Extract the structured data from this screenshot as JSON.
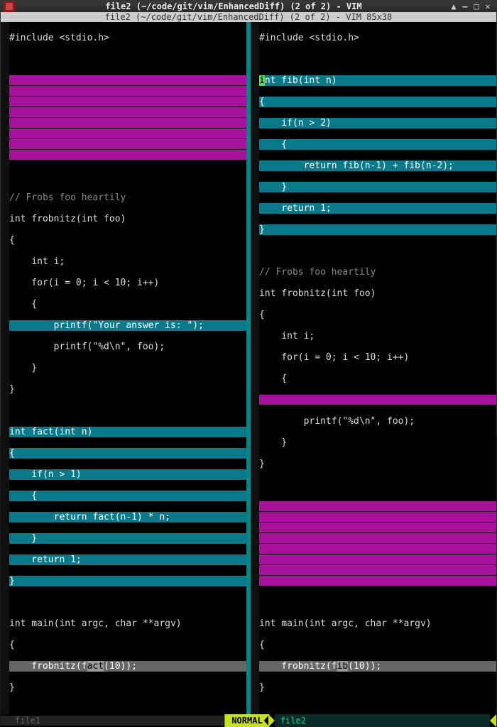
{
  "window": {
    "title": "file2 (~/code/git/vim/EnhancedDiff) (2 of 2) - VIM",
    "vim_title": "file2 (~/code/git/vim/EnhancedDiff) (2 of 2) - VIM 85x38",
    "btn_up": "▲",
    "btn_min": "–",
    "btn_max": "□",
    "btn_close": "✕"
  },
  "left": {
    "l1": "#include <stdio.h>",
    "l2": "",
    "cmt": "// Frobs foo heartily",
    "fn1": "int frobnitz(int foo)",
    "ob": "{",
    "v1": "    int i;",
    "v2": "    for(i = 0; i < 10; i++)",
    "ob2": "    {",
    "p1": "        printf(\"Your answer is: \");",
    "p2": "        printf(\"%d\\n\", foo);",
    "cb": "    }",
    "cb2": "}",
    "fn2": "int fact(int n)",
    "fb": "{",
    "if1": "    if(n > 1)",
    "ob3": "    {",
    "ret1": "        return fact(n-1) * n;",
    "cb3": "    }",
    "ret2": "    return 1;",
    "cb4": "}",
    "main": "int main(int argc, char **argv)",
    "mb": "{",
    "call_a": "    frobnitz(f",
    "call_b": "act",
    "call_c": "(10));",
    "cb5": "}"
  },
  "right": {
    "l1": "#include <stdio.h>",
    "l2": "",
    "fn0a": "nt fib(int n)",
    "fb": "{",
    "if0": "    if(n > 2)",
    "ob0": "    {",
    "ret0": "        return fib(n-1) + fib(n-2);",
    "cb0": "    }",
    "ret0b": "    return 1;",
    "cb0b": "}",
    "cmt": "// Frobs foo heartily",
    "fn1": "int frobnitz(int foo)",
    "ob": "{",
    "v1": "    int i;",
    "v2": "    for(i = 0; i < 10; i++)",
    "ob2": "    {",
    "p2": "        printf(\"%d\\n\", foo);",
    "cb": "    }",
    "cb2": "}",
    "main": "int main(int argc, char **argv)",
    "mb": "{",
    "call_a": "    frobnitz(f",
    "call_b": "ib",
    "call_c": "(10));",
    "cb5": "}"
  },
  "cmd": {
    "file1": "file1",
    "mode": "NORMAL",
    "file2": "file2"
  }
}
